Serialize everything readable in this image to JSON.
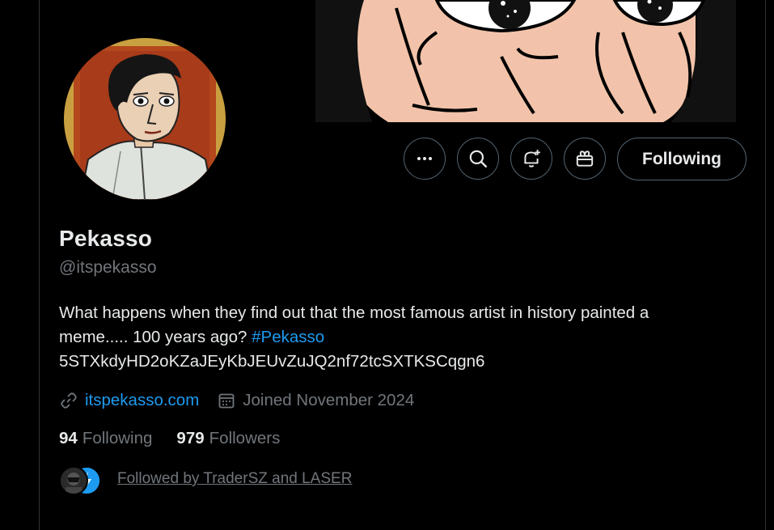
{
  "profile": {
    "name": "Pekasso",
    "handle": "@itspekasso",
    "bio_line1": "What happens when they find out that the most famous artist in history painted a",
    "bio_line2_text": "meme..... 100 years ago? ",
    "bio_hashtag": "#Pekasso",
    "bio_line3": "5STXkdyHD2oKZaJEyKbJEUvZuJQ2nf72tcSXTKSCqgn6",
    "website": "itspekasso.com",
    "joined": "Joined November 2024"
  },
  "actions": {
    "more_icon": "more-horizontal-icon",
    "search_icon": "search-icon",
    "notify_icon": "bell-plus-icon",
    "gift_icon": "gift-icon",
    "following_label": "Following"
  },
  "stats": {
    "following_count": "94",
    "following_label": "Following",
    "followers_count": "979",
    "followers_label": "Followers"
  },
  "followed_by": {
    "text": "Followed by TraderSZ and LASER"
  },
  "colors": {
    "background": "#000000",
    "text_primary": "#e7e9ea",
    "text_secondary": "#71767b",
    "accent": "#1d9bf0",
    "border": "#536471"
  }
}
